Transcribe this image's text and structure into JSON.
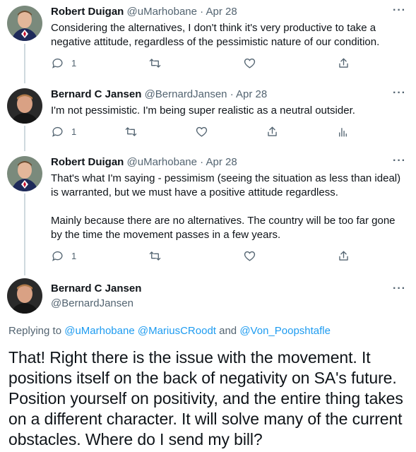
{
  "tweets": [
    {
      "name": "Robert Duigan",
      "handle": "@uMarhobane",
      "dot": "·",
      "date": "Apr 28",
      "text": [
        "Considering the alternatives, I don't think it's very productive to take a negative attitude, regardless of the pessimistic nature of our condition."
      ],
      "reply_count": "1",
      "avatar": "robert-avatar"
    },
    {
      "name": "Bernard C Jansen",
      "handle": "@BernardJansen",
      "dot": "·",
      "date": "Apr 28",
      "text": [
        "I'm not pessimistic. I'm being super realistic as a neutral outsider."
      ],
      "reply_count": "1",
      "avatar": "bernard-avatar"
    },
    {
      "name": "Robert Duigan",
      "handle": "@uMarhobane",
      "dot": "·",
      "date": "Apr 28",
      "text": [
        "That's what I'm saying - pessimism (seeing the situation as less than ideal) is warranted, but we must have a positive attitude regardless.",
        "Mainly because there are no alternatives. The country will be too far gone by the time the movement passes in a few years."
      ],
      "reply_count": "1",
      "avatar": "robert-avatar"
    }
  ],
  "main_tweet": {
    "name": "Bernard C Jansen",
    "handle": "@BernardJansen",
    "replying_prefix": "Replying to ",
    "mention_1": "@uMarhobane",
    "mention_2": "@MariusCRoodt",
    "and_word": "and",
    "mention_3": "@Von_Poopshtafle",
    "text": "That! Right there is the issue with the movement. It positions itself on the back of negativity on SA's future. Position yourself on positivity, and the entire thing takes on a different character. It will solve many of the current obstacles. Where do I send my bill?"
  },
  "more_glyph": "···",
  "colors": {
    "text": "#0f1419",
    "secondary": "#536471",
    "link": "#1d9bf0",
    "line": "#cfd9de"
  }
}
